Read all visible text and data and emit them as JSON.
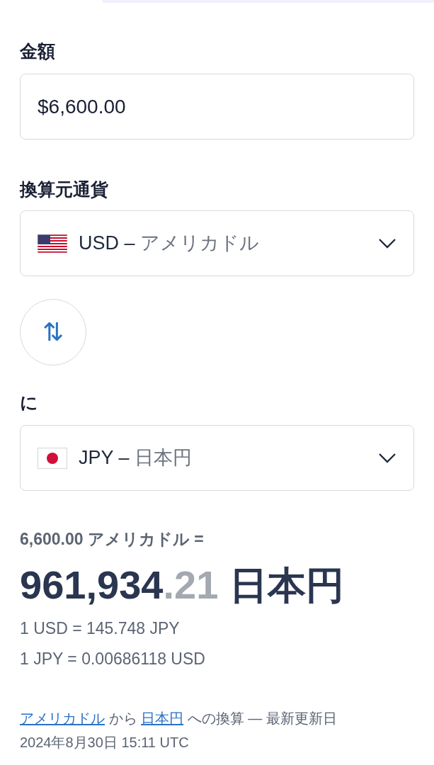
{
  "amount": {
    "label": "金額",
    "value": "$6,600.00"
  },
  "from": {
    "label": "換算元通貨",
    "kind": "us",
    "code": "USD",
    "dash": "–",
    "name": "アメリカドル"
  },
  "swap": {
    "icon": "⇅"
  },
  "to": {
    "label": "に",
    "kind": "jp",
    "code": "JPY",
    "dash": "–",
    "name": "日本円"
  },
  "result": {
    "summary": "6,600.00 アメリカドル =",
    "whole": "961,934",
    "fraction": ".21",
    "unit": "日本円",
    "rates": [
      "1 USD = 145.748 JPY",
      "1 JPY = 0.00686118 USD"
    ]
  },
  "footer": {
    "from_link": "アメリカドル",
    "from_word": "から",
    "to_link": "日本円",
    "rest": "への換算 — 最新更新日",
    "date": "2024年8月30日 15:11 UTC"
  }
}
